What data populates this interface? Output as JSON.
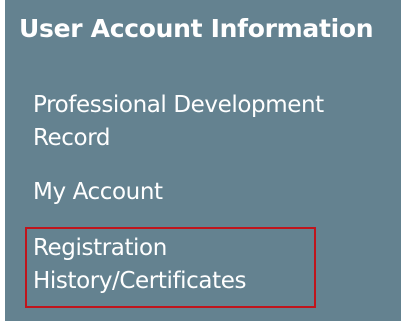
{
  "sidebar": {
    "heading": "User Account Information",
    "items": [
      {
        "label_line1": "Professional Development",
        "label_line2": "Record"
      },
      {
        "label_line1": "My Account"
      },
      {
        "label_line1": "Registration",
        "label_line2": "History/Certificates",
        "highlighted": true
      }
    ],
    "highlight_color": "#c0141c",
    "background_color": "#648290"
  }
}
